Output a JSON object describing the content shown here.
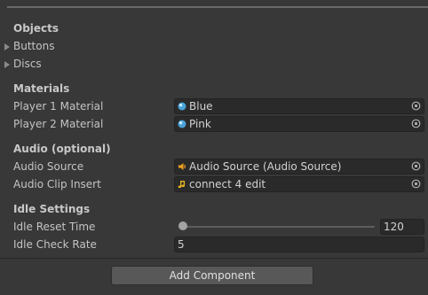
{
  "sections": {
    "objects": {
      "header": "Objects",
      "items": [
        "Buttons",
        "Discs"
      ]
    },
    "materials": {
      "header": "Materials",
      "player1_label": "Player 1 Material",
      "player1_value": "Blue",
      "player2_label": "Player 2 Material",
      "player2_value": "Pink"
    },
    "audio": {
      "header": "Audio (optional)",
      "source_label": "Audio Source",
      "source_value": "Audio Source (Audio Source)",
      "clip_label": "Audio Clip Insert",
      "clip_value": "connect 4 edit"
    },
    "idle": {
      "header": "Idle Settings",
      "reset_label": "Idle Reset Time",
      "reset_value": "120",
      "reset_slider_fraction": 0.0,
      "check_label": "Idle Check Rate",
      "check_value": "5"
    }
  },
  "add_component_label": "Add Component",
  "icons": {
    "material": "material-sphere-icon",
    "audio_source": "audio-source-speaker-icon",
    "audio_clip": "audio-clip-note-icon",
    "picker": "object-picker-icon",
    "fold": "foldout-arrow-icon"
  },
  "colors": {
    "background": "#383838",
    "field": "#2a2a2a",
    "material_blue": "#4aa3d8",
    "audio_orange": "#f0a020",
    "clip_yellow": "#e6b422",
    "button": "#585858"
  }
}
